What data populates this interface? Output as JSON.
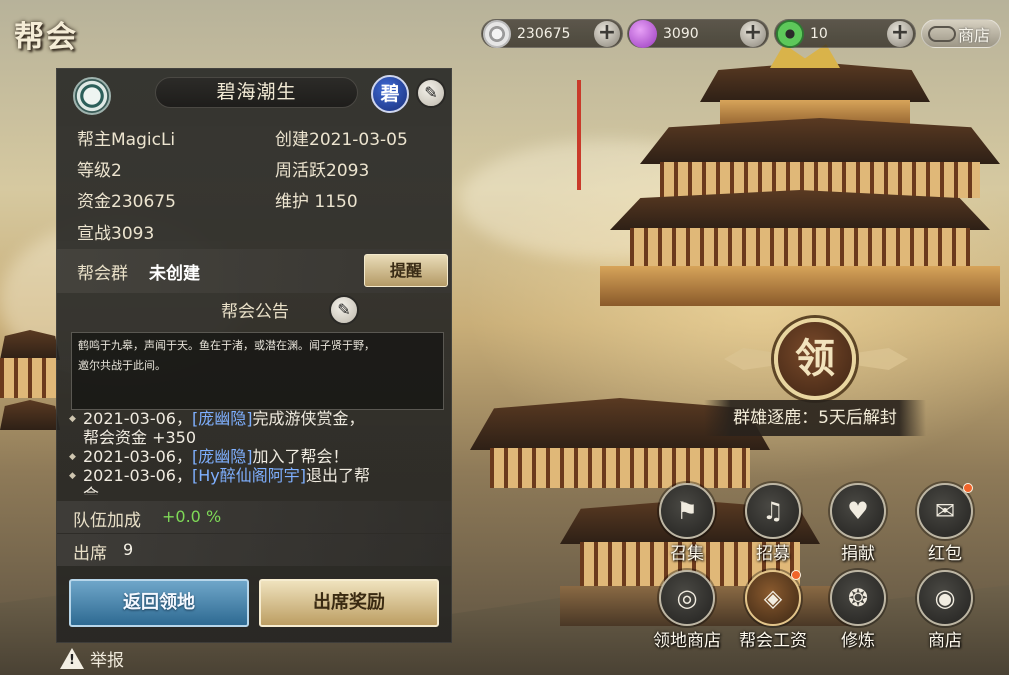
{
  "header": {
    "title": "帮会"
  },
  "currencies": [
    {
      "icon": "silver-coin-icon",
      "value": "230675"
    },
    {
      "icon": "purple-gem-icon",
      "value": "3090"
    },
    {
      "icon": "green-jade-icon",
      "value": "10"
    }
  ],
  "shop_top_label": "商店",
  "guild": {
    "name": "碧海潮生",
    "badge": "碧",
    "leader": "帮主MagicLi",
    "created": "创建2021-03-05",
    "level": "等级2",
    "weekly_activity": "周活跃2093",
    "funds": "资金230675",
    "maintenance": "维护 1150",
    "war": "宣战3093"
  },
  "group": {
    "label": "帮会群",
    "value": "未创建",
    "remind_button": "提醒"
  },
  "notice": {
    "title": "帮会公告",
    "text_line1": "鹤鸣于九皋，声闻于天。鱼在于渚，或潜在渊。闻子贤于野，",
    "text_line2": "邀尔共战于此间。"
  },
  "log": [
    {
      "date": "2021-03-06，",
      "who": "[庞幽隐]",
      "action": "完成游侠赏金，",
      "extra": "帮会资金 +350"
    },
    {
      "date": "2021-03-06，",
      "who": "[庞幽隐]",
      "action": "加入了帮会！",
      "extra": ""
    },
    {
      "date": "2021-03-06，",
      "who": "[Hy醉仙阁阿宇]",
      "action": "退出了帮",
      "extra": "会"
    }
  ],
  "stats": {
    "team_bonus_label": "队伍加成",
    "team_bonus_value": "+0.0 %",
    "attendance_label": "出席",
    "attendance_value": "9"
  },
  "buttons": {
    "return": "返回领地",
    "attend_reward": "出席奖励"
  },
  "report_label": "举报",
  "lead": {
    "medal": "领",
    "banner": "群雄逐鹿：5天后解封"
  },
  "actions_row1": [
    {
      "label": "召集",
      "icon": "flag-icon",
      "dot": false
    },
    {
      "label": "招募",
      "icon": "horn-icon",
      "dot": false
    },
    {
      "label": "捐献",
      "icon": "heart-hand-icon",
      "dot": false
    },
    {
      "label": "红包",
      "icon": "red-envelope-icon",
      "dot": true
    }
  ],
  "actions_row2": [
    {
      "label": "领地商店",
      "icon": "territory-shop-icon",
      "dot": false
    },
    {
      "label": "帮会工资",
      "icon": "salary-icon",
      "dot": true
    },
    {
      "label": "修炼",
      "icon": "cultivate-icon",
      "dot": false
    },
    {
      "label": "商店",
      "icon": "shop-icon",
      "dot": false
    }
  ],
  "colors": {
    "accent_blue": "#2e6a92",
    "accent_gold": "#bc9e63",
    "bonus_green": "#7ed957",
    "link_blue": "#7fb0ff",
    "badge_red": "#f0642a"
  }
}
